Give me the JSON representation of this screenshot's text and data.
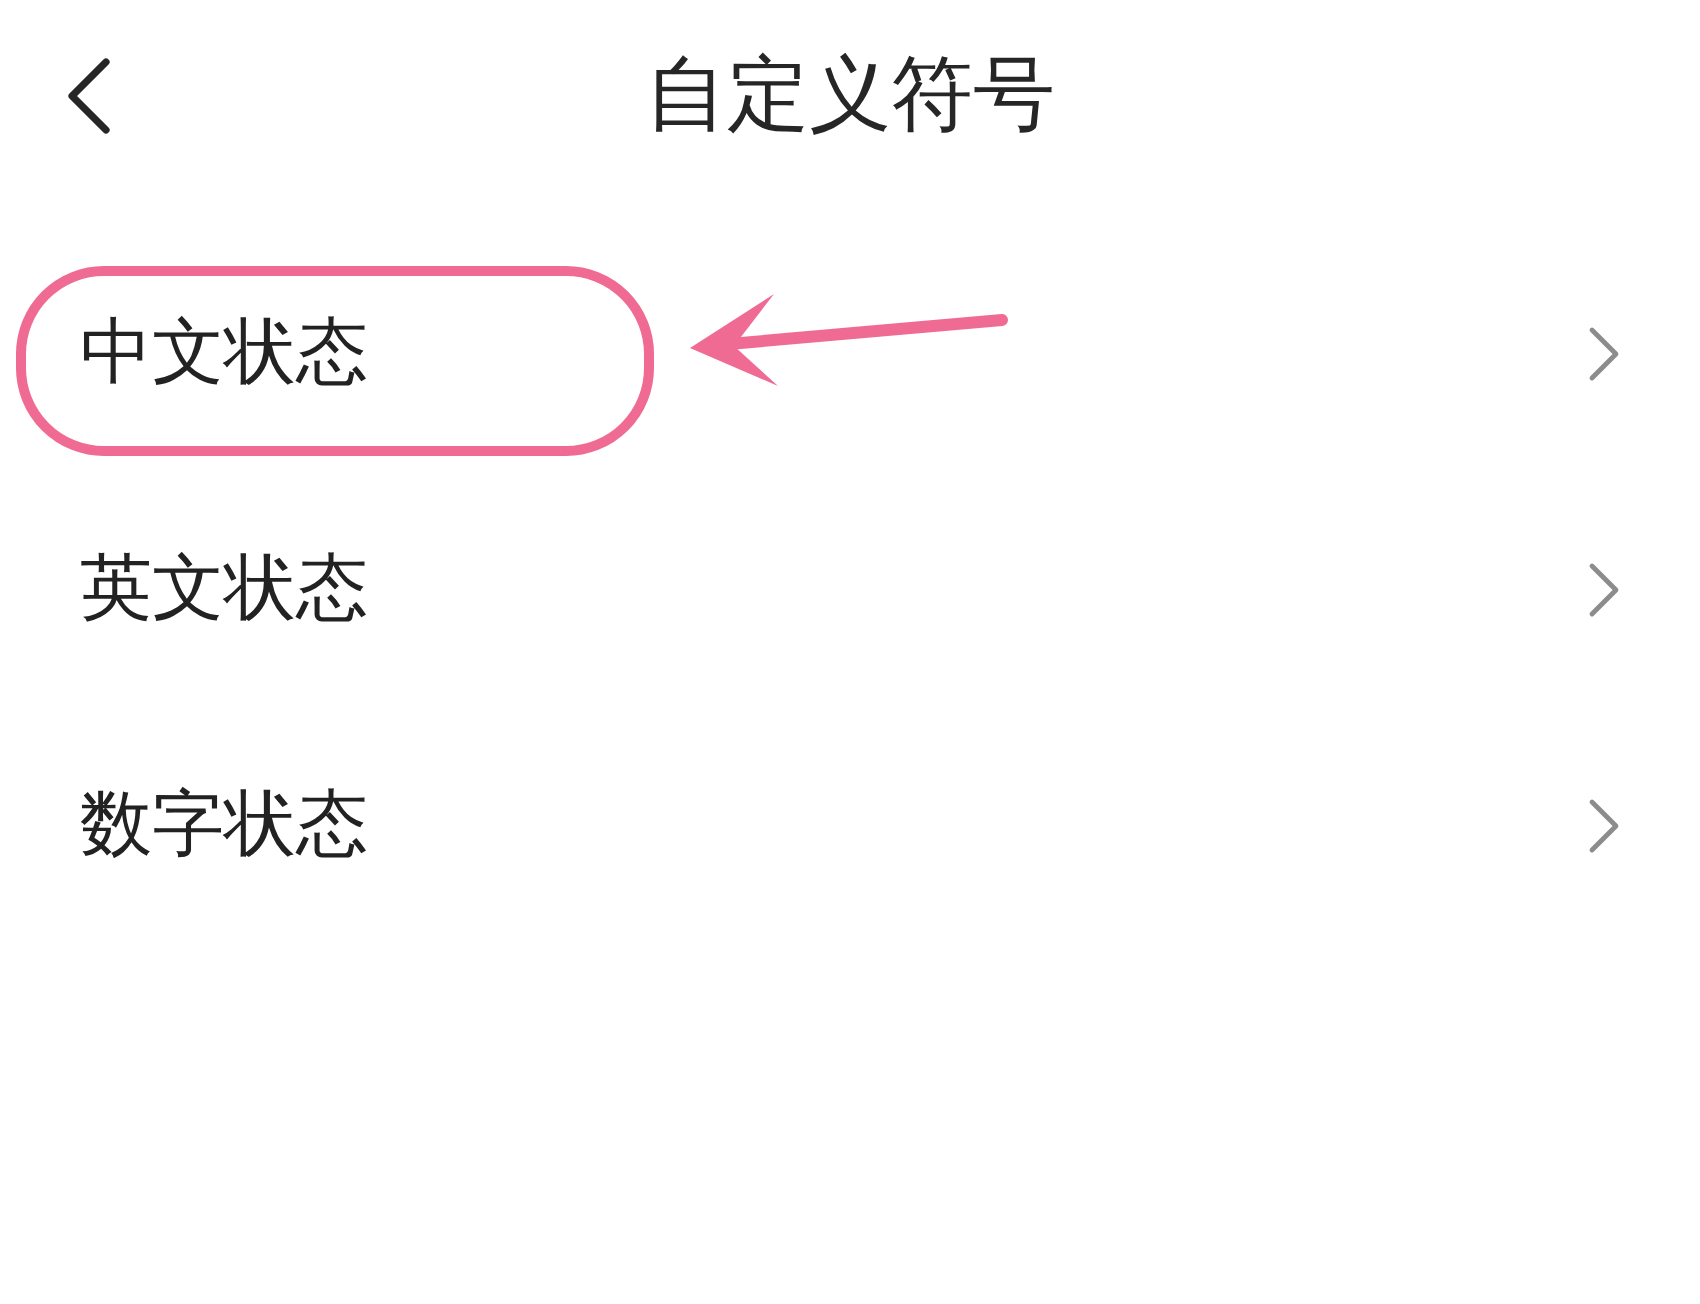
{
  "header": {
    "title": "自定义符号"
  },
  "items": [
    {
      "label": "中文状态",
      "highlighted": true
    },
    {
      "label": "英文状态",
      "highlighted": false
    },
    {
      "label": "数字状态",
      "highlighted": false
    }
  ]
}
